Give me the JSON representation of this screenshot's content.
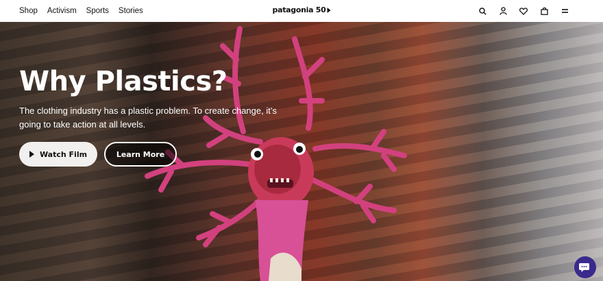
{
  "header": {
    "nav": [
      "Shop",
      "Activism",
      "Sports",
      "Stories"
    ],
    "logo_text": "patagonia 50",
    "icons": [
      "search-icon",
      "account-icon",
      "heart-icon",
      "bag-icon",
      "menu-icon"
    ]
  },
  "hero": {
    "title": "Why Plastics?",
    "subtitle": "The clothing industry has a plastic problem. To create change, it’s going to take action at all levels.",
    "watch_label": "Watch Film",
    "learn_label": "Learn More"
  },
  "chat": {
    "icon": "chat-icon",
    "color": "#3a2a8c"
  }
}
